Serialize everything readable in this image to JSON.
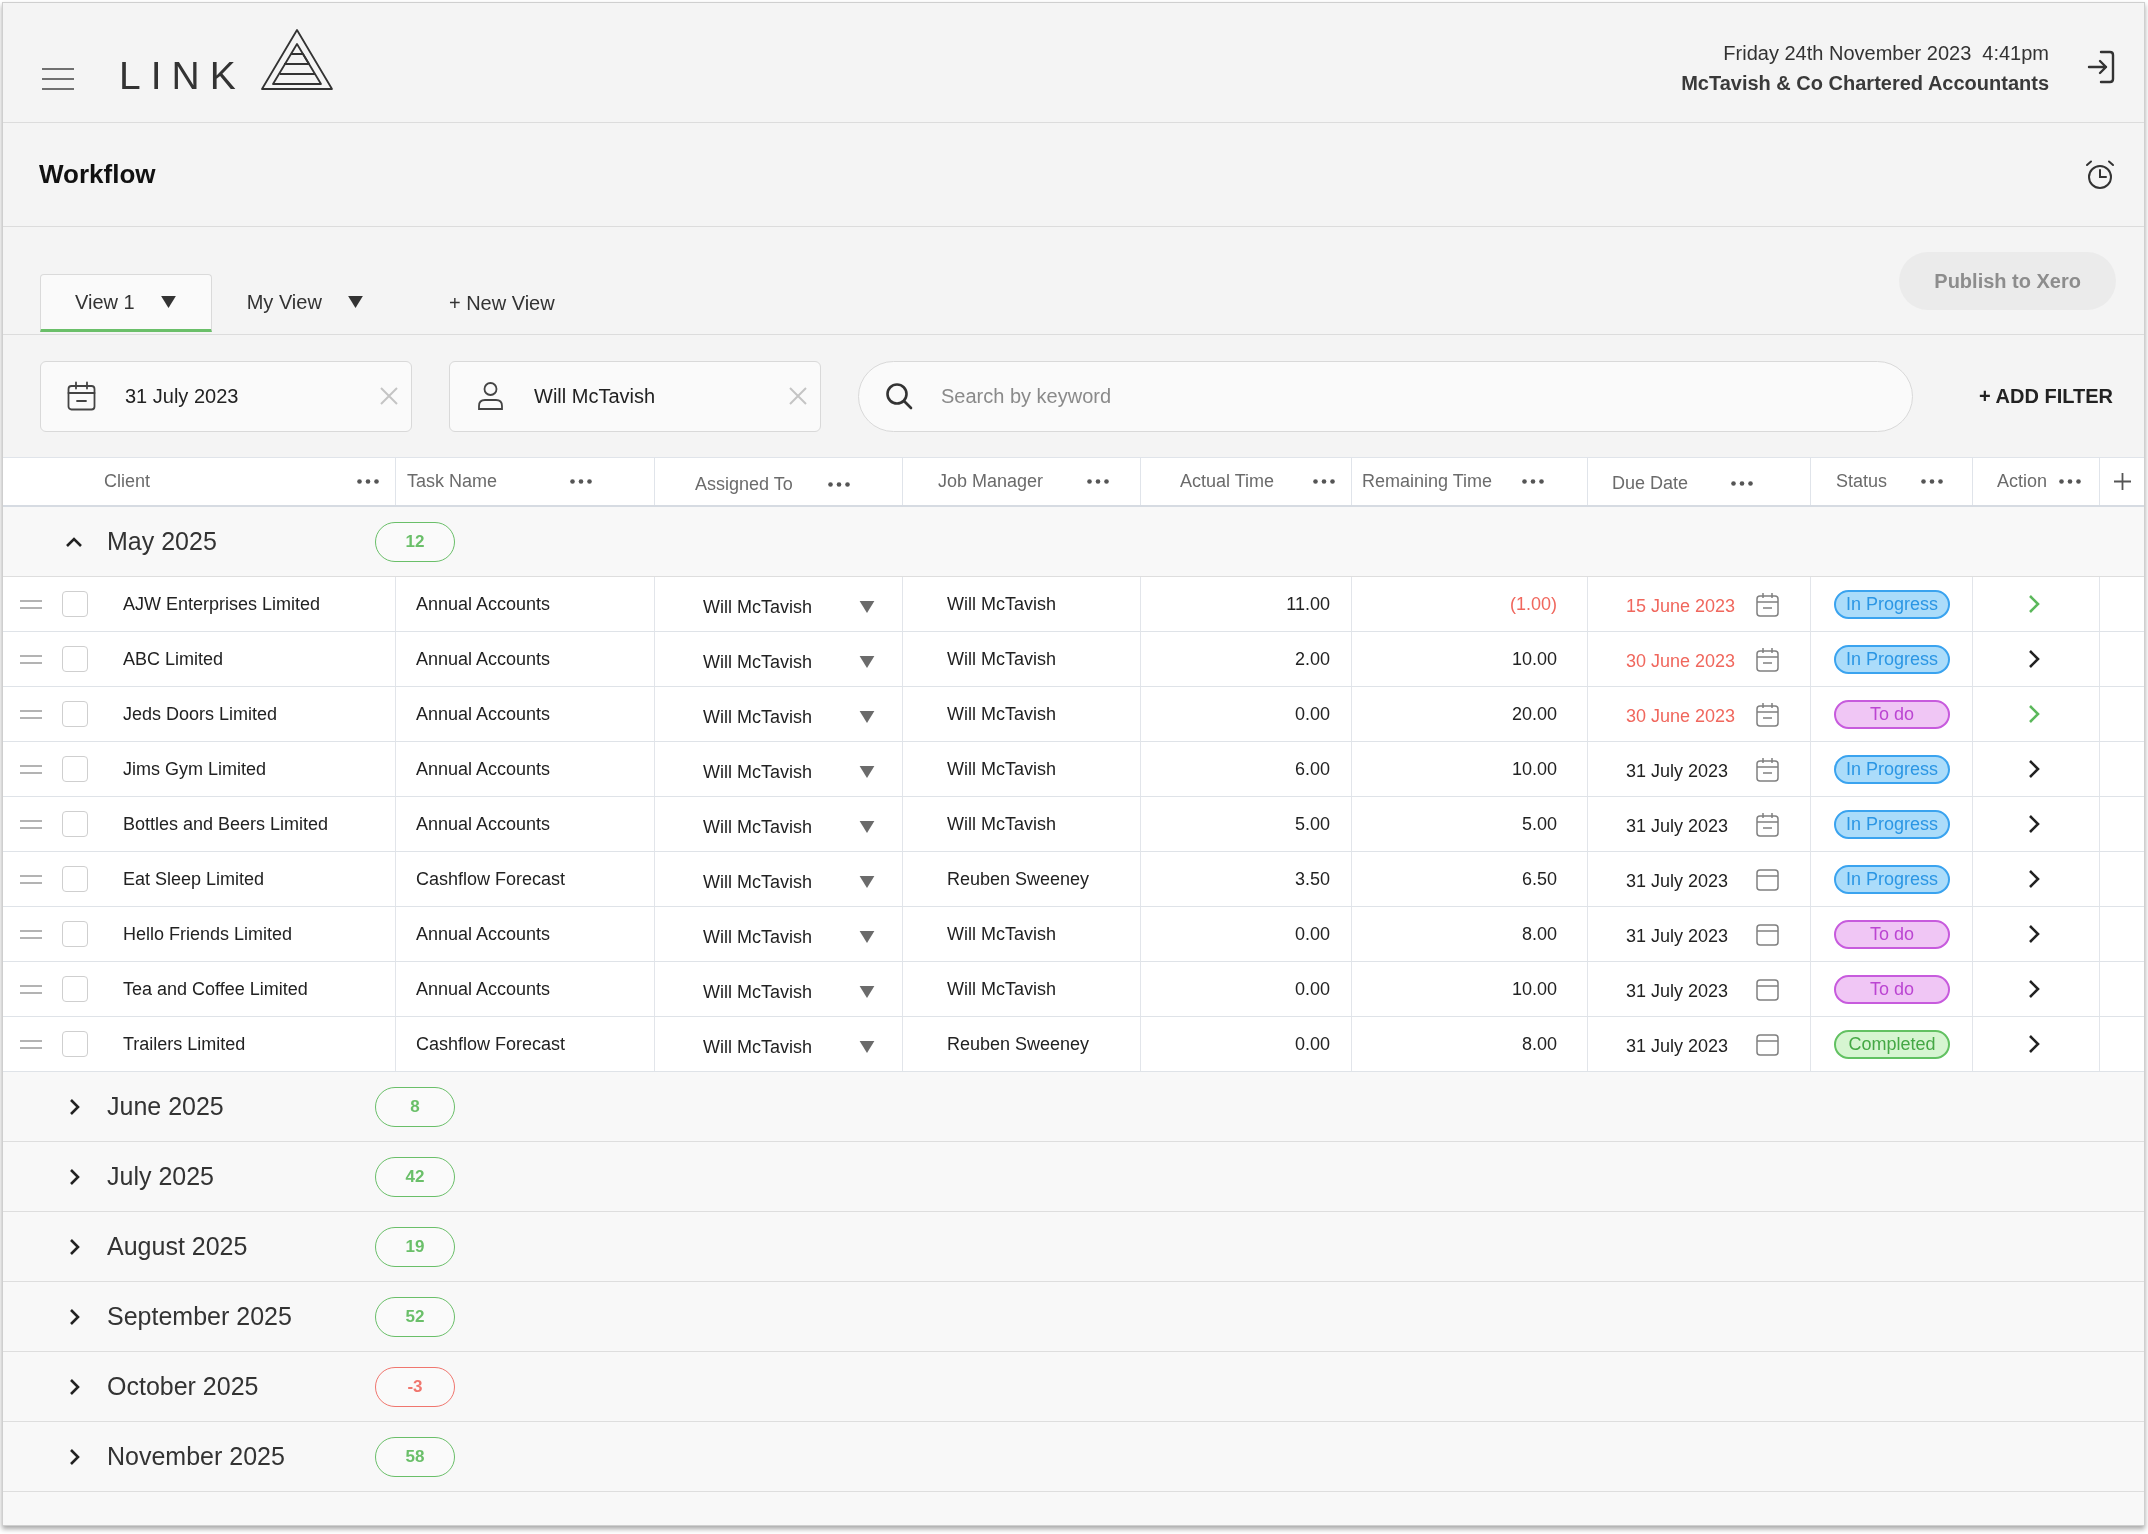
{
  "header": {
    "logo": "LINK",
    "date": "Friday 24th November 2023",
    "time": "4:41pm",
    "company": "McTavish & Co Chartered Accountants"
  },
  "page": {
    "title": "Workflow"
  },
  "views": {
    "tabs": [
      {
        "label": "View 1",
        "selected": true
      },
      {
        "label": "My View",
        "selected": false
      }
    ],
    "new_view": "+ New View",
    "publish_button": {
      "label": "Publish to Xero",
      "disabled": true
    }
  },
  "filters": {
    "date": {
      "value": "31 July 2023"
    },
    "assignee": {
      "value": "Will McTavish"
    },
    "search": {
      "placeholder": "Search by keyword"
    },
    "add_filter": "+ ADD FILTER"
  },
  "table": {
    "columns": [
      "Client",
      "Task Name",
      "Assigned To",
      "Job Manager",
      "Actual Time",
      "Remaining Time",
      "Due Date",
      "Status",
      "Action"
    ],
    "groups": [
      {
        "label": "May 2025",
        "count": "12",
        "color": "#6abf69",
        "expanded": true,
        "rows": [
          {
            "checked": false,
            "client": "AJW Enterprises Limited",
            "task": "Annual Accounts",
            "assigned_to": "Will McTavish",
            "job_manager": "Will McTavish",
            "actual_time": "11.00",
            "remaining_time": "(1.00)",
            "over_budget": true,
            "due_date": "15 June 2023",
            "overdue": true,
            "due_icon": {
              "kind": "marked"
            },
            "status": {
              "label": "In Progress",
              "kind": "in_progress"
            },
            "action": {
              "color": "#5cb85c"
            }
          },
          {
            "checked": false,
            "client": "ABC Limited",
            "task": "Annual Accounts",
            "assigned_to": "Will McTavish",
            "job_manager": "Will McTavish",
            "actual_time": "2.00",
            "remaining_time": "10.00",
            "over_budget": false,
            "due_date": "30 June 2023",
            "overdue": true,
            "due_icon": {
              "kind": "marked"
            },
            "status": {
              "label": "In Progress",
              "kind": "in_progress"
            },
            "action": {
              "color": "#222222"
            }
          },
          {
            "checked": false,
            "client": "Jeds Doors Limited",
            "task": "Annual Accounts",
            "assigned_to": "Will McTavish",
            "job_manager": "Will McTavish",
            "actual_time": "0.00",
            "remaining_time": "20.00",
            "over_budget": false,
            "due_date": "30 June 2023",
            "overdue": true,
            "due_icon": {
              "kind": "marked"
            },
            "status": {
              "label": "To do",
              "kind": "to_do"
            },
            "action": {
              "color": "#5cb85c"
            }
          },
          {
            "checked": false,
            "client": "Jims Gym Limited",
            "task": "Annual Accounts",
            "assigned_to": "Will McTavish",
            "job_manager": "Will McTavish",
            "actual_time": "6.00",
            "remaining_time": "10.00",
            "over_budget": false,
            "due_date": "31 July 2023",
            "overdue": false,
            "due_icon": {
              "kind": "marked"
            },
            "status": {
              "label": "In Progress",
              "kind": "in_progress"
            },
            "action": {
              "color": "#222222"
            }
          },
          {
            "checked": false,
            "client": "Bottles and Beers Limited",
            "task": "Annual Accounts",
            "assigned_to": "Will McTavish",
            "job_manager": "Will McTavish",
            "actual_time": "5.00",
            "remaining_time": "5.00",
            "over_budget": false,
            "due_date": "31 July 2023",
            "overdue": false,
            "due_icon": {
              "kind": "marked"
            },
            "status": {
              "label": "In Progress",
              "kind": "in_progress"
            },
            "action": {
              "color": "#222222"
            }
          },
          {
            "checked": false,
            "client": "Eat Sleep Limited",
            "task": "Cashflow Forecast",
            "assigned_to": "Will McTavish",
            "job_manager": "Reuben Sweeney",
            "actual_time": "3.50",
            "remaining_time": "6.50",
            "over_budget": false,
            "due_date": "31 July 2023",
            "overdue": false,
            "due_icon": {
              "kind": "empty"
            },
            "status": {
              "label": "In Progress",
              "kind": "in_progress"
            },
            "action": {
              "color": "#222222"
            }
          },
          {
            "checked": false,
            "client": "Hello Friends Limited",
            "task": "Annual Accounts",
            "assigned_to": "Will McTavish",
            "job_manager": "Will McTavish",
            "actual_time": "0.00",
            "remaining_time": "8.00",
            "over_budget": false,
            "due_date": "31 July 2023",
            "overdue": false,
            "due_icon": {
              "kind": "empty"
            },
            "status": {
              "label": "To do",
              "kind": "to_do"
            },
            "action": {
              "color": "#222222"
            }
          },
          {
            "checked": false,
            "client": "Tea and Coffee Limited",
            "task": "Annual Accounts",
            "assigned_to": "Will McTavish",
            "job_manager": "Will McTavish",
            "actual_time": "0.00",
            "remaining_time": "10.00",
            "over_budget": false,
            "due_date": "31 July 2023",
            "overdue": false,
            "due_icon": {
              "kind": "empty"
            },
            "status": {
              "label": "To do",
              "kind": "to_do"
            },
            "action": {
              "color": "#222222"
            }
          },
          {
            "checked": false,
            "client": "Trailers Limited",
            "task": "Cashflow Forecast",
            "assigned_to": "Will McTavish",
            "job_manager": "Reuben Sweeney",
            "actual_time": "0.00",
            "remaining_time": "8.00",
            "over_budget": false,
            "due_date": "31 July 2023",
            "overdue": false,
            "due_icon": {
              "kind": "empty"
            },
            "status": {
              "label": "Completed",
              "kind": "completed"
            },
            "action": {
              "color": "#222222"
            }
          }
        ]
      },
      {
        "label": "June 2025",
        "count": "8",
        "color": "#6abf69",
        "expanded": false
      },
      {
        "label": "July 2025",
        "count": "42",
        "color": "#6abf69",
        "expanded": false
      },
      {
        "label": "August 2025",
        "count": "19",
        "color": "#6abf69",
        "expanded": false
      },
      {
        "label": "September 2025",
        "count": "52",
        "color": "#6abf69",
        "expanded": false
      },
      {
        "label": "October 2025",
        "count": "-3",
        "color": "#f0766e",
        "expanded": false
      },
      {
        "label": "November 2025",
        "count": "58",
        "color": "#6abf69",
        "expanded": false
      }
    ]
  }
}
